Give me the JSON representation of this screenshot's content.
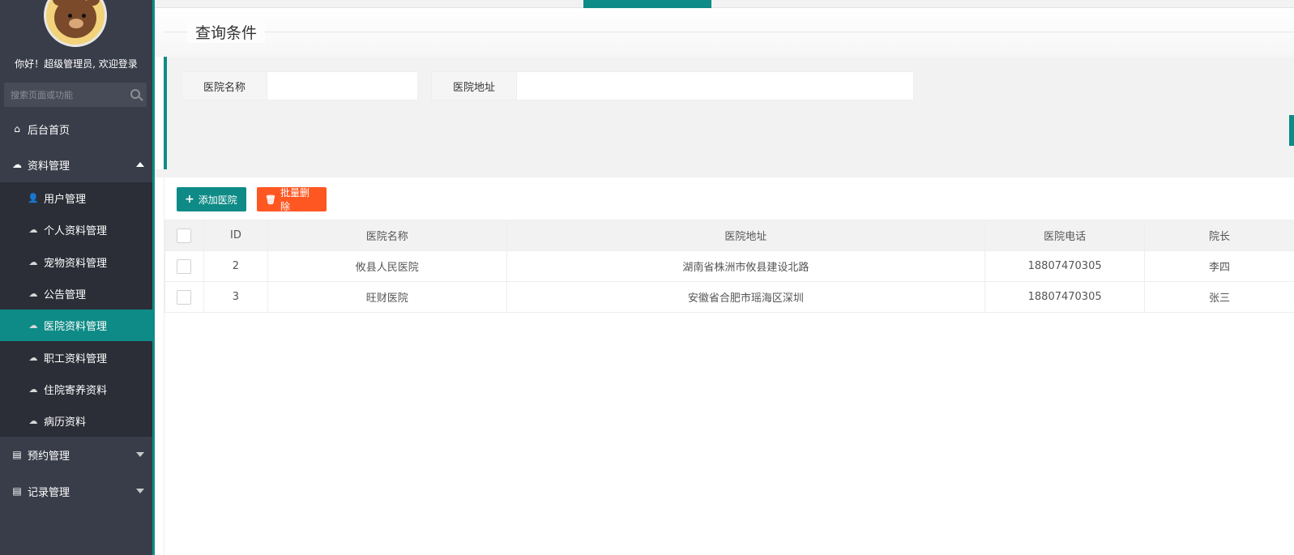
{
  "sidebar": {
    "welcome": "你好！超级管理员, 欢迎登录",
    "search_placeholder": "搜索页面或功能",
    "home": "后台首页",
    "data_mgmt": "资料管理",
    "sub_items": [
      {
        "label": "用户管理",
        "icon": "user-icon"
      },
      {
        "label": "个人资料管理",
        "icon": "cloud-icon"
      },
      {
        "label": "宠物资料管理",
        "icon": "cloud-icon"
      },
      {
        "label": "公告管理",
        "icon": "cloud-icon"
      },
      {
        "label": "医院资料管理",
        "icon": "cloud-icon",
        "active": true
      },
      {
        "label": "职工资料管理",
        "icon": "cloud-icon"
      },
      {
        "label": "住院寄养资料",
        "icon": "cloud-icon"
      },
      {
        "label": "病历资料",
        "icon": "cloud-icon"
      }
    ],
    "appointment_mgmt": "预约管理",
    "record_mgmt": "记录管理"
  },
  "query": {
    "title": "查询条件",
    "name_label": "医院名称",
    "name_value": "",
    "addr_label": "医院地址",
    "addr_value": ""
  },
  "toolbar": {
    "add_label": "添加医院",
    "delete_label": "批量删除"
  },
  "table": {
    "headers": [
      "ID",
      "医院名称",
      "医院地址",
      "医院电话",
      "院长"
    ],
    "rows": [
      [
        "2",
        "攸县人民医院",
        "湖南省株洲市攸县建设北路",
        "18807470305",
        "李四"
      ],
      [
        "3",
        "旺财医院",
        "安徽省合肥市瑶海区深圳",
        "18807470305",
        "张三"
      ]
    ]
  },
  "colors": {
    "accent": "#0e8b86",
    "danger": "#ff5722",
    "sidebar_bg": "#393d49",
    "submenu_bg": "#2b2e37"
  }
}
